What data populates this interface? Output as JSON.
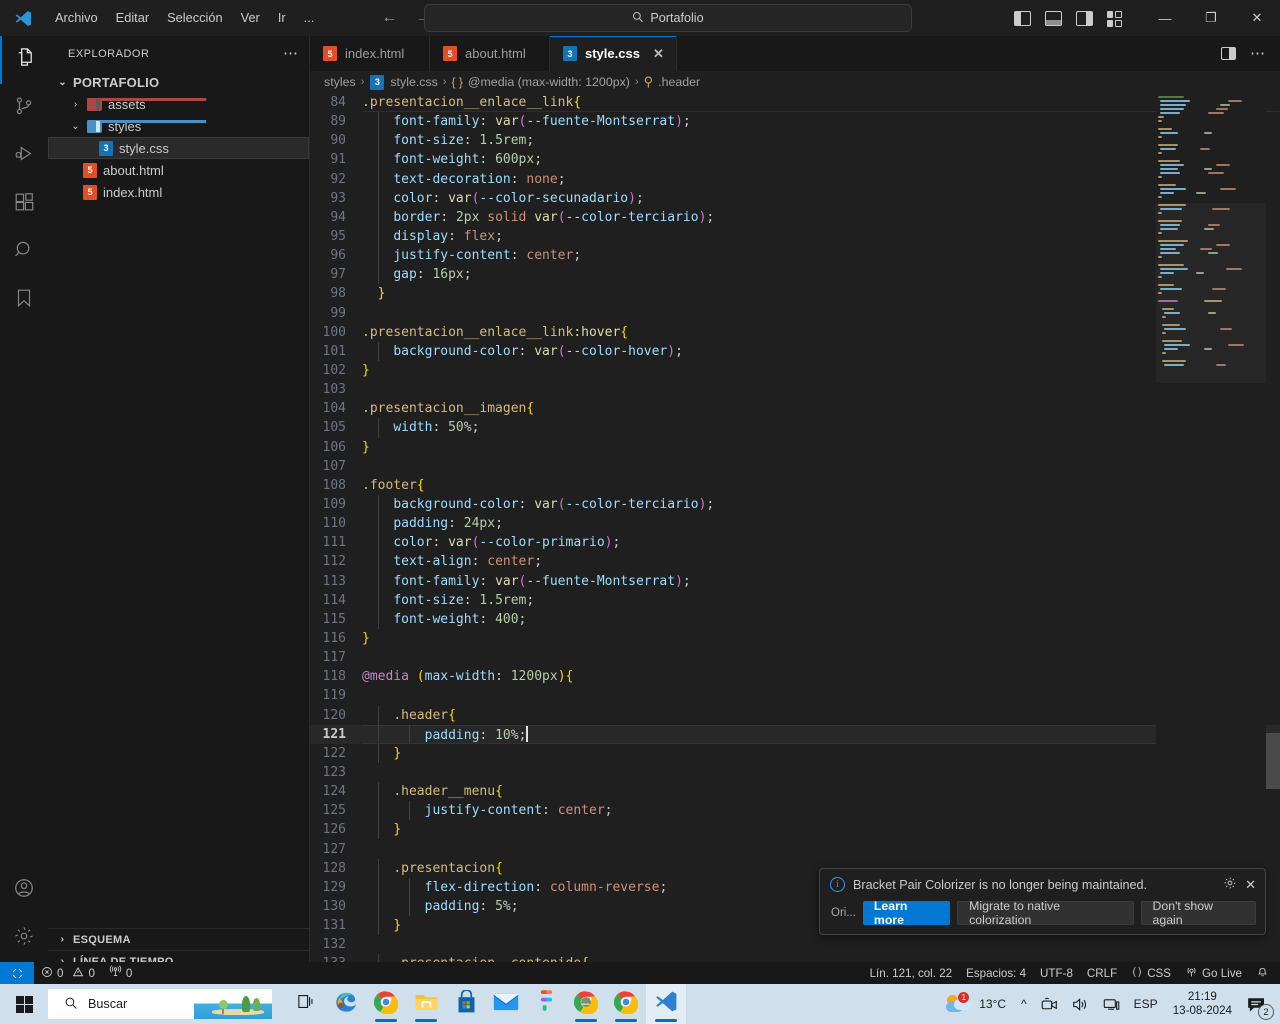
{
  "titlebar": {
    "menu": [
      "Archivo",
      "Editar",
      "Selección",
      "Ver",
      "Ir",
      "..."
    ],
    "search_value": "Portafolio",
    "search_icon": "search-icon",
    "back_arrow": "←",
    "forward_arrow": "→",
    "minimize": "—",
    "maximize": "❐",
    "close": "✕"
  },
  "activitybar": {
    "items": [
      {
        "name": "explorer",
        "icon": "files-icon"
      },
      {
        "name": "source-control",
        "icon": "source-control-icon"
      },
      {
        "name": "run-and-debug",
        "icon": "run-debug-icon"
      },
      {
        "name": "extensions",
        "icon": "extensions-icon"
      },
      {
        "name": "search",
        "icon": "search-icon"
      },
      {
        "name": "bookmarks",
        "icon": "bookmark-icon"
      }
    ],
    "bottom": [
      {
        "name": "accounts",
        "icon": "account-icon"
      },
      {
        "name": "settings",
        "icon": "gear-icon"
      }
    ]
  },
  "sidebar": {
    "title": "EXPLORADOR",
    "more_actions": "⋯",
    "root": "PORTAFOLIO",
    "tree": [
      {
        "label": "assets",
        "type": "folder",
        "expanded": false,
        "chevron": "›",
        "depth": 1
      },
      {
        "label": "styles",
        "type": "folder",
        "expanded": true,
        "chevron": "⌄",
        "depth": 1
      },
      {
        "label": "style.css",
        "type": "css",
        "depth": 2,
        "selected": true
      },
      {
        "label": "about.html",
        "type": "html",
        "depth": 1
      },
      {
        "label": "index.html",
        "type": "html",
        "depth": 1
      }
    ],
    "sections": [
      {
        "label": "ESQUEMA",
        "chevron": "›"
      },
      {
        "label": "LÍNEA DE TIEMPO",
        "chevron": "›"
      }
    ]
  },
  "tabs": [
    {
      "label": "index.html",
      "type": "html",
      "active": false
    },
    {
      "label": "about.html",
      "type": "html",
      "active": false
    },
    {
      "label": "style.css",
      "type": "css",
      "active": true,
      "close": "✕"
    }
  ],
  "breadcrumb": {
    "folder": "styles",
    "file": "style.css",
    "symbol_brace": "{ }",
    "symbol": "@media (max-width: 1200px)",
    "selector": ".header",
    "separator": "›"
  },
  "code": {
    "language": "css",
    "lines": [
      {
        "n": 84,
        "text": ".presentacion__enlace__link{",
        "indent": 0
      },
      {
        "n": 89,
        "text": "    font-family: var(--fuente-Montserrat);",
        "indent": 1
      },
      {
        "n": 90,
        "text": "    font-size: 1.5rem;",
        "indent": 1
      },
      {
        "n": 91,
        "text": "    font-weight: 600px;",
        "indent": 1
      },
      {
        "n": 92,
        "text": "    text-decoration: none;",
        "indent": 1
      },
      {
        "n": 93,
        "text": "    color: var(--color-secunadario);",
        "indent": 1
      },
      {
        "n": 94,
        "text": "    border: 2px solid var(--color-terciario);",
        "indent": 1
      },
      {
        "n": 95,
        "text": "    display: flex;",
        "indent": 1
      },
      {
        "n": 96,
        "text": "    justify-content: center;",
        "indent": 1
      },
      {
        "n": 97,
        "text": "    gap: 16px;",
        "indent": 1
      },
      {
        "n": 98,
        "text": "  }",
        "indent": 0
      },
      {
        "n": 99,
        "text": "",
        "indent": 0
      },
      {
        "n": 100,
        "text": ".presentacion__enlace__link:hover{",
        "indent": 0
      },
      {
        "n": 101,
        "text": "    background-color: var(--color-hover);",
        "indent": 1
      },
      {
        "n": 102,
        "text": "}",
        "indent": 0
      },
      {
        "n": 103,
        "text": "",
        "indent": 0
      },
      {
        "n": 104,
        "text": ".presentacion__imagen{",
        "indent": 0
      },
      {
        "n": 105,
        "text": "    width: 50%;",
        "indent": 1
      },
      {
        "n": 106,
        "text": "}",
        "indent": 0
      },
      {
        "n": 107,
        "text": "",
        "indent": 0
      },
      {
        "n": 108,
        "text": ".footer{",
        "indent": 0
      },
      {
        "n": 109,
        "text": "    background-color: var(--color-terciario);",
        "indent": 1
      },
      {
        "n": 110,
        "text": "    padding: 24px;",
        "indent": 1
      },
      {
        "n": 111,
        "text": "    color: var(--color-primario);",
        "indent": 1
      },
      {
        "n": 112,
        "text": "    text-align: center;",
        "indent": 1
      },
      {
        "n": 113,
        "text": "    font-family: var(--fuente-Montserrat);",
        "indent": 1
      },
      {
        "n": 114,
        "text": "    font-size: 1.5rem;",
        "indent": 1
      },
      {
        "n": 115,
        "text": "    font-weight: 400;",
        "indent": 1
      },
      {
        "n": 116,
        "text": "}",
        "indent": 0
      },
      {
        "n": 117,
        "text": "",
        "indent": 0
      },
      {
        "n": 118,
        "text": "@media (max-width: 1200px){",
        "indent": 0
      },
      {
        "n": 119,
        "text": "",
        "indent": 0
      },
      {
        "n": 120,
        "text": "    .header{",
        "indent": 1
      },
      {
        "n": 121,
        "text": "        padding: 10%;",
        "indent": 2,
        "current": true
      },
      {
        "n": 122,
        "text": "    }",
        "indent": 1
      },
      {
        "n": 123,
        "text": "",
        "indent": 0
      },
      {
        "n": 124,
        "text": "    .header__menu{",
        "indent": 1
      },
      {
        "n": 125,
        "text": "        justify-content: center;",
        "indent": 2
      },
      {
        "n": 126,
        "text": "    }",
        "indent": 1
      },
      {
        "n": 127,
        "text": "",
        "indent": 0
      },
      {
        "n": 128,
        "text": "    .presentacion{",
        "indent": 1
      },
      {
        "n": 129,
        "text": "        flex-direction: column-reverse;",
        "indent": 2
      },
      {
        "n": 130,
        "text": "        padding: 5%;",
        "indent": 2
      },
      {
        "n": 131,
        "text": "    }",
        "indent": 1
      },
      {
        "n": 132,
        "text": "",
        "indent": 0
      },
      {
        "n": 133,
        "text": "    .presentacion__contenido{",
        "indent": 1
      }
    ]
  },
  "notification": {
    "icon": "info-icon",
    "message": "Bracket Pair Colorizer is no longer being maintained.",
    "gear_icon": "gear-icon",
    "close_icon": "close-icon",
    "source": "Ori...",
    "buttons": [
      {
        "label": "Learn more",
        "primary": true
      },
      {
        "label": "Migrate to native colorization",
        "primary": false
      },
      {
        "label": "Don't show again",
        "primary": false
      }
    ]
  },
  "statusbar": {
    "remote_icon": "remote-window-icon",
    "errors": "0",
    "warnings": "0",
    "ports": "0",
    "error_icon": "error-circle-icon",
    "warning_icon": "warning-triangle-icon",
    "ports_icon": "radio-tower-icon",
    "cursor_position": "Lín. 121, col. 22",
    "indentation": "Espacios: 4",
    "encoding": "UTF-8",
    "eol": "CRLF",
    "language": "CSS",
    "language_icon": "braces-icon",
    "go_live": "Go Live",
    "go_live_icon": "broadcast-icon",
    "bell_icon": "bell-icon"
  },
  "taskbar": {
    "start_icon": "windows-logo-icon",
    "search_placeholder": "Buscar",
    "search_icon": "search-icon",
    "taskview_icon": "task-view-icon",
    "apps": [
      {
        "name": "microsoft-edge",
        "icon": "edge-icon"
      },
      {
        "name": "google-chrome",
        "icon": "chrome-icon"
      },
      {
        "name": "file-explorer",
        "icon": "folder-icon"
      },
      {
        "name": "microsoft-store",
        "icon": "store-icon"
      },
      {
        "name": "mail",
        "icon": "mail-icon"
      },
      {
        "name": "figma",
        "icon": "figma-icon"
      },
      {
        "name": "chrome-window-2",
        "icon": "chrome-icon"
      },
      {
        "name": "chrome-window-3",
        "icon": "chrome-icon"
      },
      {
        "name": "visual-studio-code",
        "icon": "vscode-icon"
      }
    ],
    "weather_temp": "13°C",
    "weather_icon": "sun-cloud-icon",
    "tray_expand": "^",
    "tray_icons": [
      "meet-now-icon",
      "volume-icon",
      "network-icon"
    ],
    "language": "ESP",
    "time": "21:19",
    "date": "13-08-2024",
    "notification_count": "2",
    "notification_icon": "notification-icon"
  }
}
